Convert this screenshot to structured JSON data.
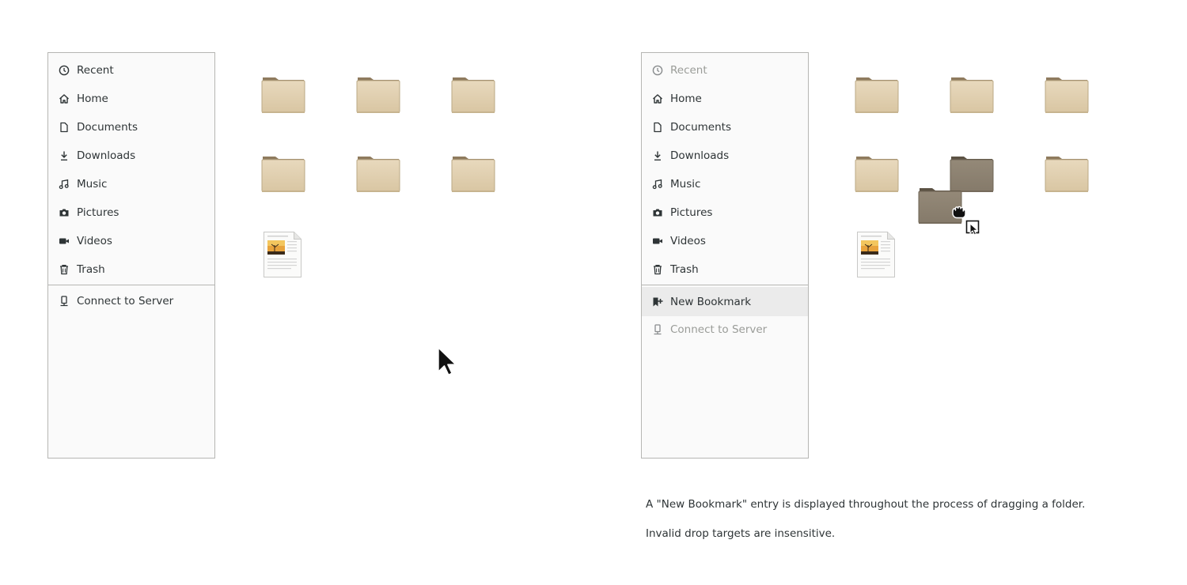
{
  "left_panel": {
    "items": [
      {
        "label": "Recent",
        "icon": "clock-icon"
      },
      {
        "label": "Home",
        "icon": "home-icon"
      },
      {
        "label": "Documents",
        "icon": "document-icon"
      },
      {
        "label": "Downloads",
        "icon": "download-icon"
      },
      {
        "label": "Music",
        "icon": "music-icon"
      },
      {
        "label": "Pictures",
        "icon": "camera-icon"
      },
      {
        "label": "Videos",
        "icon": "video-icon"
      },
      {
        "label": "Trash",
        "icon": "trash-icon"
      }
    ],
    "connect_label": "Connect to Server"
  },
  "right_panel": {
    "items": [
      {
        "label": "Recent",
        "icon": "clock-icon",
        "state": "insensitive"
      },
      {
        "label": "Home",
        "icon": "home-icon"
      },
      {
        "label": "Documents",
        "icon": "document-icon"
      },
      {
        "label": "Downloads",
        "icon": "download-icon"
      },
      {
        "label": "Music",
        "icon": "music-icon"
      },
      {
        "label": "Pictures",
        "icon": "camera-icon"
      },
      {
        "label": "Videos",
        "icon": "video-icon"
      },
      {
        "label": "Trash",
        "icon": "trash-icon"
      }
    ],
    "new_bookmark_label": "New Bookmark",
    "connect_label": "Connect to Server"
  },
  "captions": {
    "line1": "A \"New Bookmark\" entry is displayed throughout the process of dragging a folder.",
    "line2": "Invalid drop targets are insensitive."
  },
  "colors": {
    "folder_body": "#e0cfb0",
    "folder_tab": "#8f7b5e",
    "folder_dragged": "#8a7f70",
    "insensitive_text": "#9a9c98",
    "highlight_row": "#ebebeb"
  }
}
